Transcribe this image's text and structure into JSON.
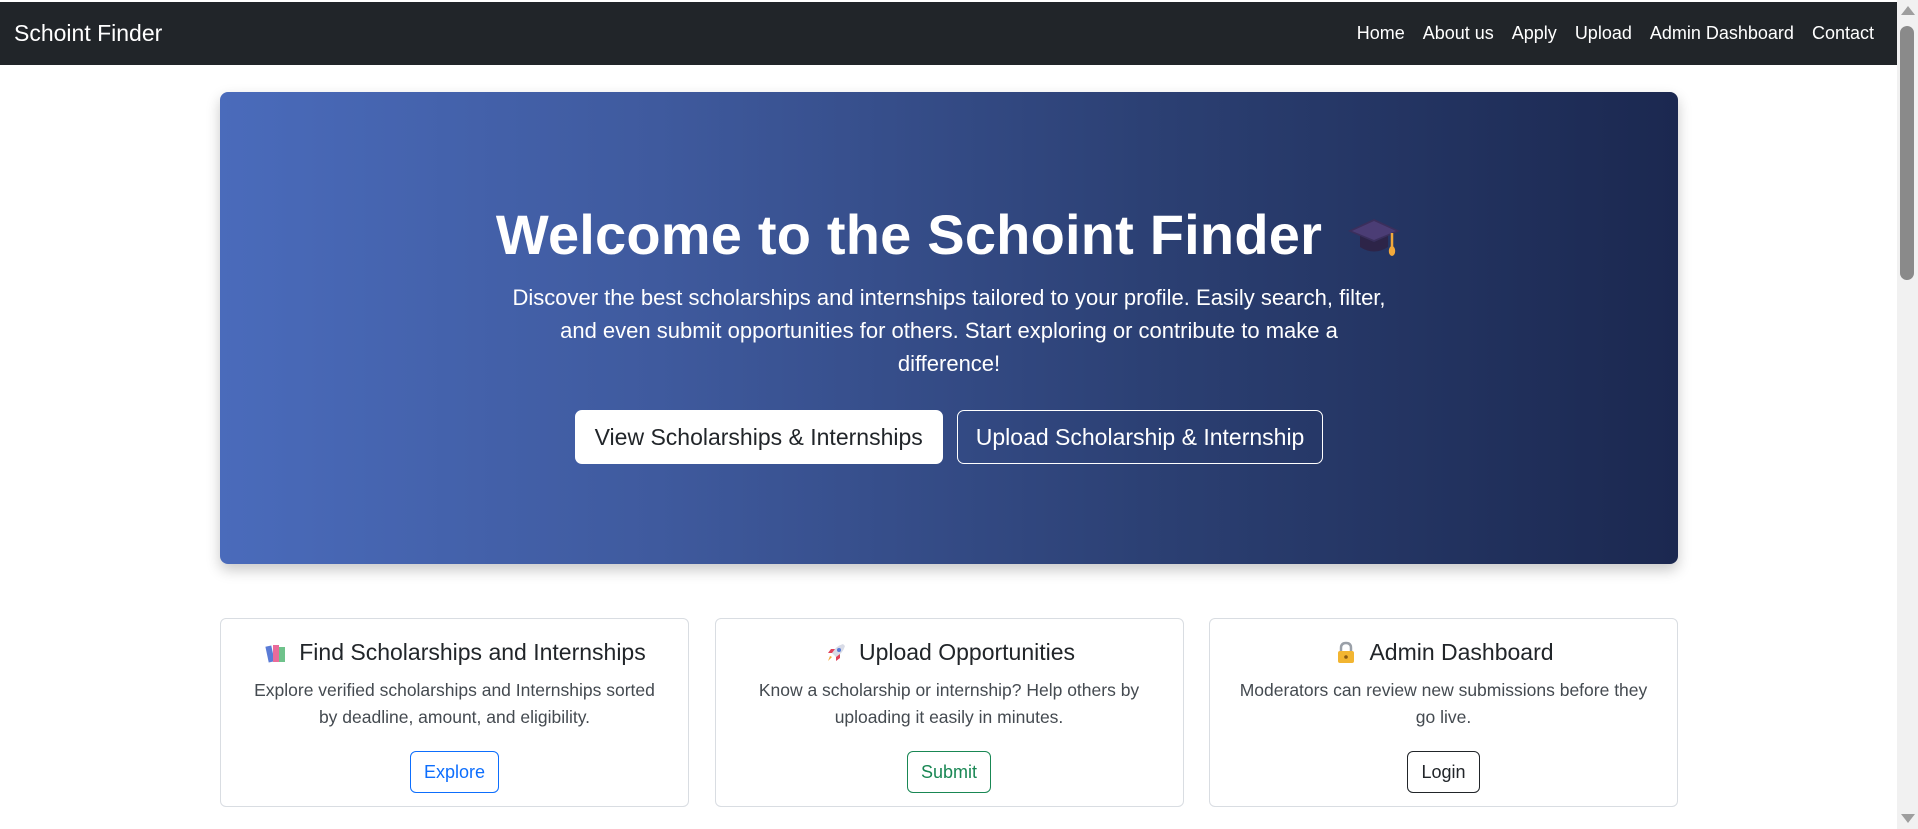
{
  "navbar": {
    "brand": "Schoint Finder",
    "links": [
      "Home",
      "About us",
      "Apply",
      "Upload",
      "Admin Dashboard",
      "Contact"
    ]
  },
  "hero": {
    "title": "Welcome to the Schoint Finder",
    "title_icon": "graduation-cap-icon",
    "description": "Discover the best scholarships and internships tailored to your profile. Easily search, filter, and even submit opportunities for others. Start exploring or contribute to make a difference!",
    "primary_button": "View Scholarships & Internships",
    "secondary_button": "Upload Scholarship & Internship",
    "gradient_start": "#4a6bbb",
    "gradient_end": "#1b2850"
  },
  "cards": [
    {
      "icon": "books-icon",
      "title": "Find Scholarships and Internships",
      "description": "Explore verified scholarships and Internships sorted by deadline, amount, and eligibility.",
      "button": "Explore",
      "button_color": "#0d6efd"
    },
    {
      "icon": "rocket-icon",
      "title": "Upload Opportunities",
      "description": "Know a scholarship or internship? Help others by uploading it easily in minutes.",
      "button": "Submit",
      "button_color": "#198754"
    },
    {
      "icon": "lock-icon",
      "title": "Admin Dashboard",
      "description": "Moderators can review new submissions before they go live.",
      "button": "Login",
      "button_color": "#212529"
    }
  ]
}
